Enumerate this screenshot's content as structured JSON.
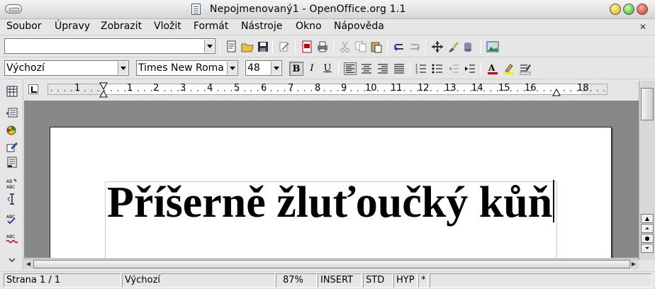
{
  "window": {
    "title": "Nepojmenovaný1 - OpenOffice.org 1.1"
  },
  "menu": {
    "soubor": "Soubor",
    "upravy": "Úpravy",
    "zobrazit": "Zobrazit",
    "vlozit": "Vložit",
    "format": "Formát",
    "nastroje": "Nástroje",
    "okno": "Okno",
    "napoveda": "Nápověda"
  },
  "funcbar": {
    "url_value": ""
  },
  "objbar": {
    "paragraph_style": "Výchozí",
    "font_name": "Times New Roma",
    "font_size": "48",
    "bold": "B",
    "italic": "I",
    "underline": "U"
  },
  "ruler": {
    "labels": [
      "1",
      "1",
      "2",
      "3",
      "4",
      "5",
      "6",
      "7",
      "8",
      "9",
      "10",
      "11",
      "12",
      "13",
      "14",
      "15",
      "16",
      "17",
      "18"
    ]
  },
  "document": {
    "text": "Příšerně žluťoučký kůň"
  },
  "statusbar": {
    "page": "Strana 1 / 1",
    "page_style": "Výchozí",
    "zoom": "87%",
    "insert_mode": "INSERT",
    "selection_mode": "STD",
    "hyperlink_mode": "HYP",
    "modified": "*"
  },
  "colors": {
    "font_color_bar": "#cc0000",
    "highlight_bar": "#f0f000",
    "workspace": "#888888"
  }
}
